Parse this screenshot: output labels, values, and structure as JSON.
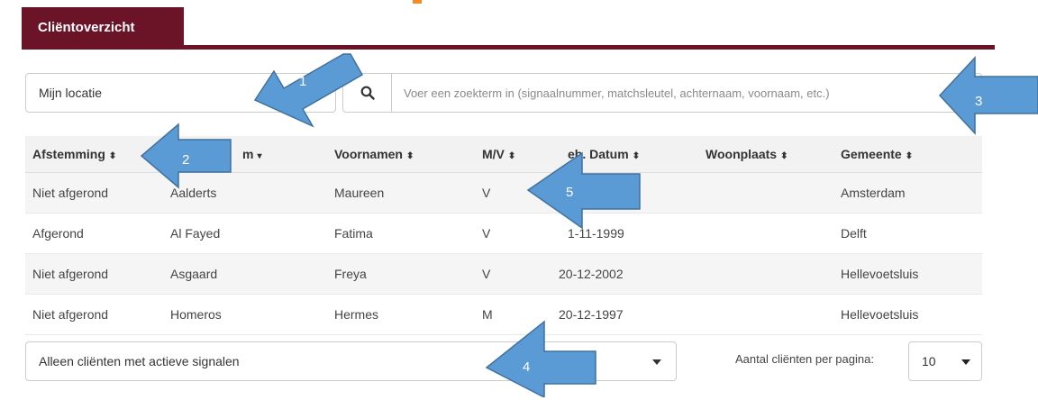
{
  "tab": {
    "label": "Cliëntoverzicht"
  },
  "location": {
    "value": "Mijn locatie"
  },
  "search": {
    "placeholder": "Voer een zoekterm in (signaalnummer, matchsleutel, achternaam, voornaam, etc.)",
    "icon": "search-icon"
  },
  "table": {
    "headers": [
      {
        "label": "Afstemming",
        "sort": "⬍"
      },
      {
        "label": "m",
        "sort": "▾"
      },
      {
        "label": "Voornamen",
        "sort": "⬍"
      },
      {
        "label": "M/V",
        "sort": "⬍"
      },
      {
        "label": "eb. Datum",
        "sort": "⬍"
      },
      {
        "label": "Woonplaats",
        "sort": "⬍"
      },
      {
        "label": "Gemeente",
        "sort": "⬍"
      }
    ],
    "rows": [
      [
        "Niet afgerond",
        "Aalderts",
        "Maureen",
        "V",
        "",
        "",
        "Amsterdam"
      ],
      [
        "Afgerond",
        "Al Fayed",
        "Fatima",
        "V",
        "1-11-1999",
        "",
        "Delft"
      ],
      [
        "Niet afgerond",
        "Asgaard",
        "Freya",
        "V",
        "20-12-2002",
        "",
        "Hellevoetsluis"
      ],
      [
        "Niet afgerond",
        "Homeros",
        "Hermes",
        "M",
        "20-12-1997",
        "",
        "Hellevoetsluis"
      ]
    ]
  },
  "filter": {
    "value": "Alleen cliënten met actieve signalen"
  },
  "pagination": {
    "label": "Aantal cliënten per pagina:",
    "value": "10"
  },
  "callouts": [
    "1",
    "2",
    "3",
    "4",
    "5"
  ],
  "colors": {
    "tab": "#6b1428",
    "arrow": "#5b9bd5",
    "arrow_border": "#41719c"
  }
}
